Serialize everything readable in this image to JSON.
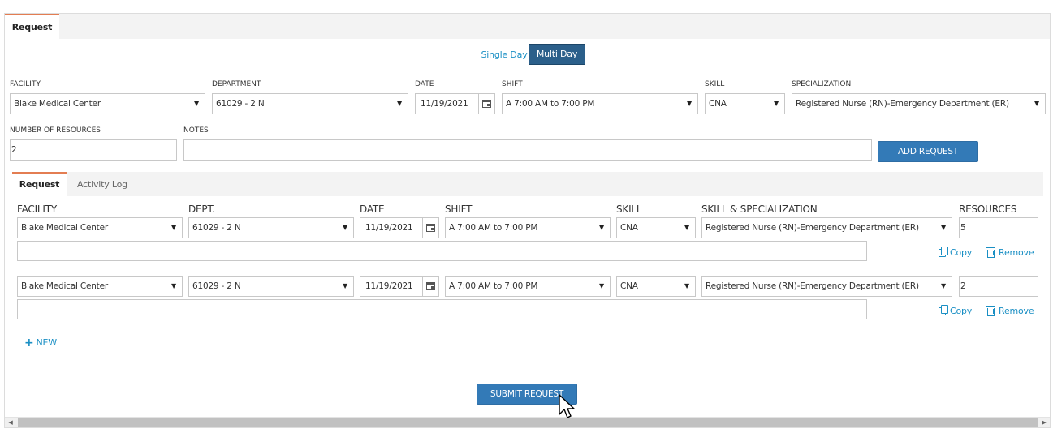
{
  "outer_tabs": {
    "request": "Request"
  },
  "mode_toggle": {
    "single_day": "Single Day",
    "multi_day": "Multi Day"
  },
  "form": {
    "labels": {
      "facility": "FACILITY",
      "department": "DEPARTMENT",
      "date": "DATE",
      "shift": "SHIFT",
      "skill": "SKILL",
      "specialization": "SPECIALIZATION",
      "number_of_resources": "NUMBER OF RESOURCES",
      "notes": "NOTES"
    },
    "values": {
      "facility": "Blake Medical Center",
      "department": "61029 - 2 N",
      "date": "11/19/2021",
      "shift": "A 7:00 AM to 7:00 PM",
      "skill": "CNA",
      "specialization": "Registered Nurse (RN)-Emergency Department (ER)",
      "number_of_resources": "2",
      "notes": ""
    },
    "add_request_label": "ADD REQUEST"
  },
  "inner_tabs": {
    "request": "Request",
    "activity_log": "Activity Log"
  },
  "table": {
    "headers": {
      "facility": "FACILITY",
      "dept": "DEPT.",
      "date": "DATE",
      "shift": "SHIFT",
      "skill": "SKILL",
      "skill_specialization": "SKILL & SPECIALIZATION",
      "resources": "RESOURCES"
    },
    "rows": [
      {
        "facility": "Blake Medical Center",
        "dept": "61029 - 2 N",
        "date": "11/19/2021",
        "shift": "A 7:00 AM to 7:00 PM",
        "skill": "CNA",
        "specialization": "Registered Nurse (RN)-Emergency Department (ER)",
        "resources": "5",
        "notes": ""
      },
      {
        "facility": "Blake Medical Center",
        "dept": "61029 - 2 N",
        "date": "11/19/2021",
        "shift": "A 7:00 AM to 7:00 PM",
        "skill": "CNA",
        "specialization": "Registered Nurse (RN)-Emergency Department (ER)",
        "resources": "2",
        "notes": ""
      }
    ],
    "copy_label": "Copy",
    "remove_label": "Remove",
    "new_label": "NEW"
  },
  "submit_label": "SUBMIT REQUEST",
  "icons": {
    "dropdown": "caret-down-icon",
    "calendar": "calendar-icon",
    "copy": "copy-icon",
    "remove": "trash-icon",
    "add": "plus-icon",
    "cursor": "mouse-pointer-icon"
  },
  "colors": {
    "primary": "#337ab7",
    "toggle_active": "#2b5f8a",
    "link": "#1a8fc4",
    "tab_accent": "#e37d52"
  }
}
